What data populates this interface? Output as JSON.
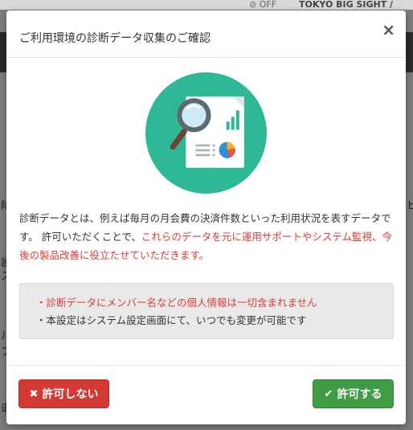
{
  "background": {
    "topbar_off": "⊘ OFF",
    "topbar_venue": "TOKYO BIG SIGHT /",
    "fragments": [
      "除",
      "ヒ",
      "設",
      "ス",
      "ル",
      "フ",
      "退"
    ]
  },
  "dialog": {
    "title": "ご利用環境の診断データ収集のご確認",
    "close_glyph": "×",
    "description_plain": "診断データとは、例えば毎月の月会費の決済件数といった利用状況を表すデータです。 許可いただくことで、",
    "description_highlight": "これらのデータを元に運用サポートやシステム監視、今後の製品改善に役立たせていただきます。",
    "notice_items": [
      "・診断データにメンバー名などの個人情報は一切含まれません",
      "・本設定はシステム設定画面にて、いつでも変更が可能です"
    ],
    "deny_label": "許可しない",
    "allow_label": "許可する"
  },
  "icons": {
    "illustration": "data-report-magnifier-icon",
    "close": "close-icon",
    "deny": "x-icon",
    "allow": "checkmark-icon"
  },
  "colors": {
    "illustration_circle": "#2fb895",
    "highlight_text": "#e03a3a",
    "deny_button": "#d33a33",
    "allow_button": "#3e9c44",
    "notice_bg": "#e9e9e9"
  }
}
